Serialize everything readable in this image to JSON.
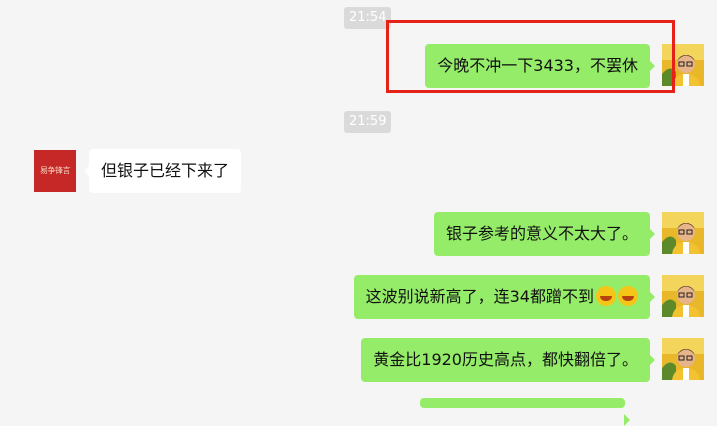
{
  "chat": {
    "timestamps": [
      "21:54",
      "21:59"
    ],
    "messages": [
      {
        "side": "out",
        "text": "今晚不冲一下3433，不罢休"
      },
      {
        "side": "in",
        "text": "但银子已经下来了"
      },
      {
        "side": "out",
        "text": "银子参考的意义不太大了。"
      },
      {
        "side": "out",
        "text": "这波别说新高了，连34都蹭不到",
        "emoji_count": 2,
        "emoji_name": "laughing-tears-emoji"
      },
      {
        "side": "out",
        "text": "黄金比1920历史高点，都快翻倍了。"
      }
    ],
    "contact_avatar_text": "易争锋言"
  },
  "colors": {
    "background": "#f5f5f5",
    "outgoing_bubble": "#95ec69",
    "incoming_bubble": "#ffffff",
    "highlight_box": "#e62117",
    "timestamp_bg": "#dadada"
  }
}
